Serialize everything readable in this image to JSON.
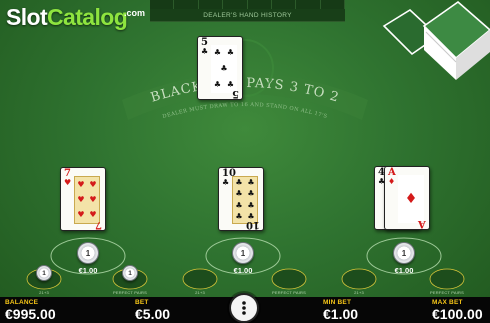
{
  "brand": {
    "logo_slot": "Slot",
    "logo_catalog": "Catalog",
    "logo_com": ".com"
  },
  "history": {
    "label": "DEALER'S HAND HISTORY"
  },
  "table": {
    "title": "BLACKJACK PAYS 3 TO 2",
    "rule": "DEALER MUST DRAW TO 16 AND STAND ON ALL 17'S",
    "colors": {
      "felt": "#2f7330",
      "felt_dark": "#21591f",
      "print": "#4e9a48"
    }
  },
  "dealer": {
    "cards": [
      {
        "rank": "5",
        "suit": "♣",
        "color": "black"
      }
    ]
  },
  "hands": [
    {
      "cards": [
        {
          "rank": "7",
          "suit": "♥",
          "color": "red"
        }
      ],
      "chip": "1",
      "bet": "€1.00",
      "side_bets": [
        {
          "chip": "1",
          "label": "21+3"
        },
        {
          "chip": "1",
          "label": "PERFECT PAIRS"
        }
      ]
    },
    {
      "cards": [
        {
          "rank": "10",
          "suit": "♣",
          "color": "black"
        }
      ],
      "chip": "1",
      "bet": "€1.00",
      "side_bets": [
        {
          "label": "21+3"
        },
        {
          "label": "PERFECT PAIRS"
        }
      ]
    },
    {
      "cards": [
        {
          "rank": "4",
          "suit": "♣",
          "color": "black"
        },
        {
          "rank": "A",
          "suit": "♦",
          "color": "red"
        }
      ],
      "chip": "1",
      "bet": "€1.00",
      "side_bets": [
        {
          "label": "21+3"
        },
        {
          "label": "PERFECT PAIRS"
        }
      ]
    }
  ],
  "footer": {
    "balance_label": "BALANCE",
    "balance_value": "€995.00",
    "bet_label": "BET",
    "bet_value": "€5.00",
    "min_bet_label": "MIN BET",
    "min_bet_value": "€1.00",
    "max_bet_label": "MAX BET",
    "max_bet_value": "€100.00",
    "menu_icon": "more-vertical-icon",
    "accent": "#f5c518"
  }
}
